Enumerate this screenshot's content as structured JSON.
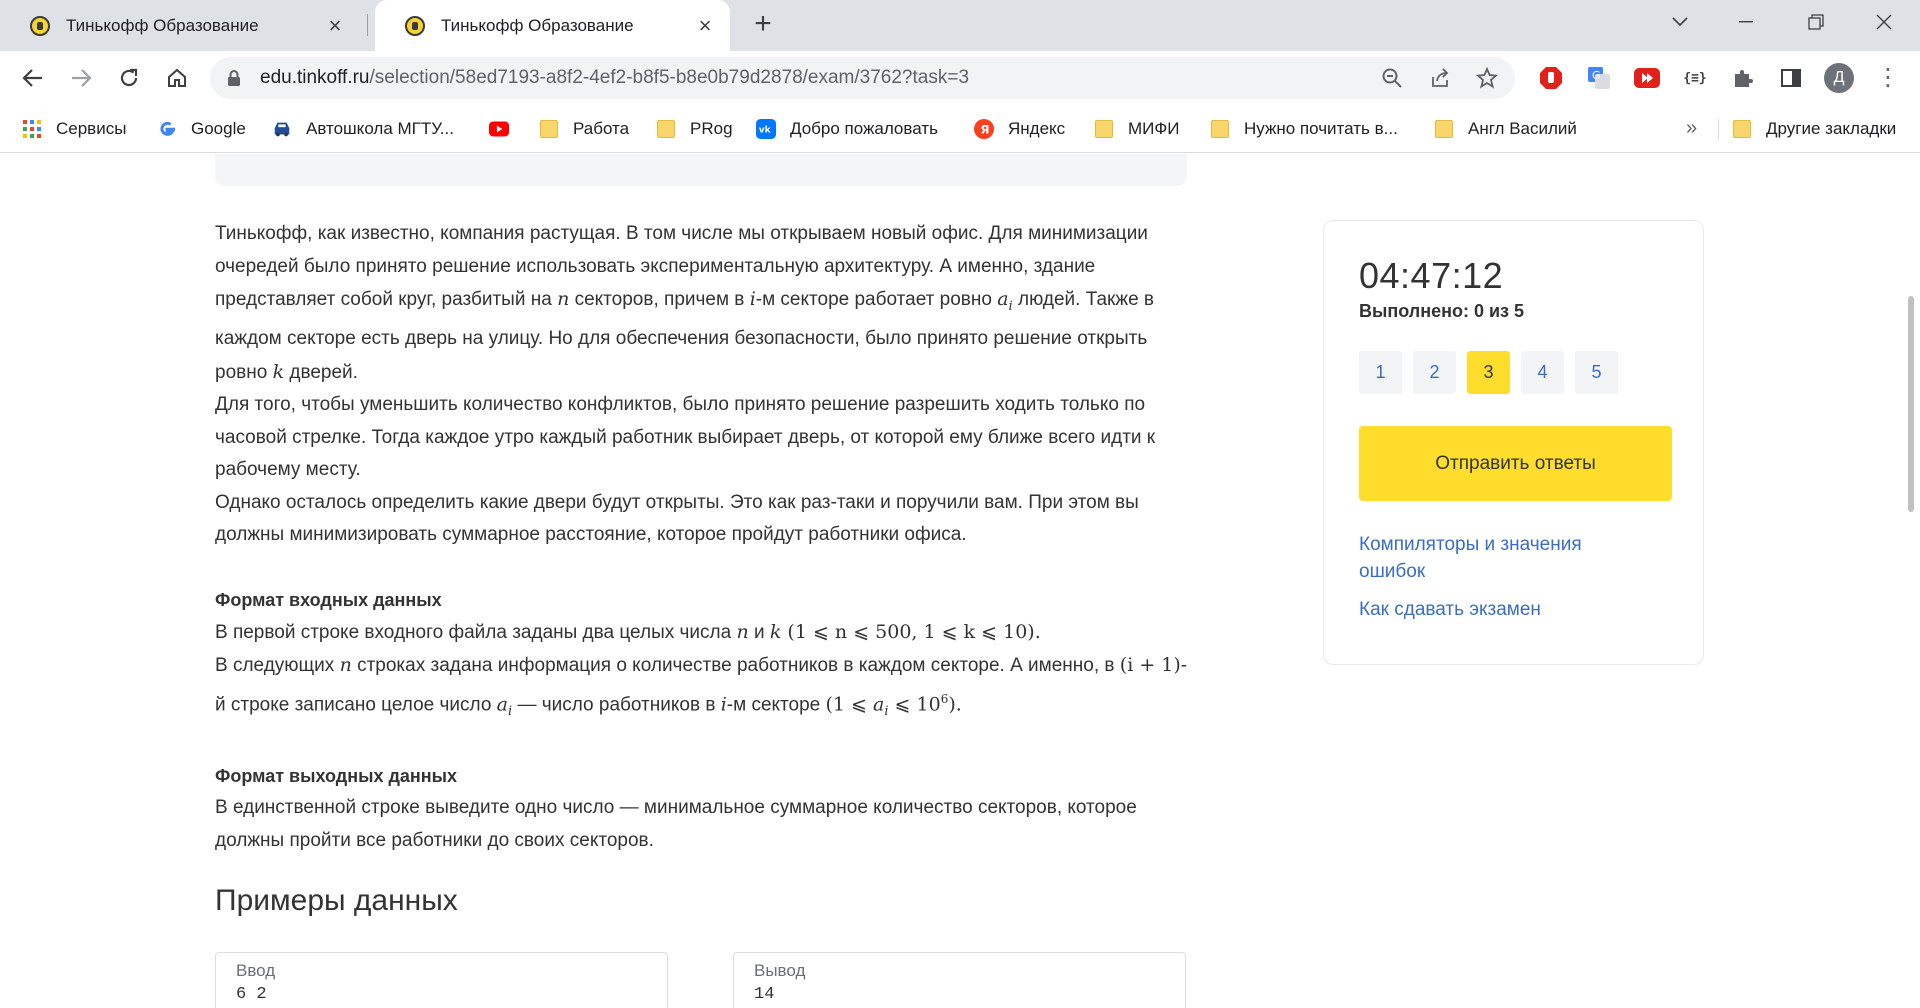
{
  "browser": {
    "tabs": [
      {
        "title": "Тинькофф Образование",
        "active": false
      },
      {
        "title": "Тинькофф Образование",
        "active": true
      }
    ],
    "new_tab_label": "+",
    "url_host": "edu.tinkoff.ru",
    "url_path": "/selection/58ed7193-a8f2-4ef2-b8f5-b8e0b79d2878/exam/3762?task=3",
    "profile_initial": "Д",
    "bookmarks": [
      {
        "label": "Сервисы",
        "icon": "apps-grid-icon"
      },
      {
        "label": "Google",
        "icon": "google-icon"
      },
      {
        "label": "Автошкола МГТУ...",
        "icon": "car-icon"
      },
      {
        "label": "",
        "icon": "youtube-icon"
      },
      {
        "label": "Работа",
        "icon": "folder-icon"
      },
      {
        "label": "PRog",
        "icon": "folder-icon"
      },
      {
        "label": "Добро пожаловать",
        "icon": "vk-icon"
      },
      {
        "label": "Яндекс",
        "icon": "yandex-icon"
      },
      {
        "label": "МИФИ",
        "icon": "folder-icon"
      },
      {
        "label": "Нужно почитать в...",
        "icon": "folder-icon"
      },
      {
        "label": "Англ Василий",
        "icon": "folder-icon"
      }
    ],
    "bookmarks_more": "»",
    "other_bookmarks": "Другие закладки"
  },
  "task": {
    "p1": {
      "a": "Тинькофф, как известно, компания растущая. В том числе мы открываем новый офис. Для минимизации очередей было принято решение использовать экспериментальную архитектуру. А именно, здание представляет собой круг, разбитый на ",
      "n": "n",
      "b": " секторов, причем в ",
      "i": "i",
      "c": "-м секторе работает ровно ",
      "ai": "a",
      "ai_sub": "i",
      "d": " людей. Также в каждом секторе есть дверь на улицу. Но для обеспечения безопасности, было принято решение открыть ровно ",
      "k": "k",
      "e": " дверей."
    },
    "p2": "Для того, чтобы уменьшить количество конфликтов, было принято решение разрешить ходить только по часовой стрелке. Тогда каждое утро каждый работник выбирает дверь, от которой ему ближе всего идти к рабочему месту.",
    "p3": "Однако осталось определить какие двери будут открыты. Это как раз-таки и поручили вам. При этом вы должны минимизировать суммарное расстояние, которое пройдут работники офиса.",
    "input_title": "Формат входных данных",
    "input_1": {
      "a": "В первой строке входного файла заданы два целых числа ",
      "n": "n",
      "and": " и ",
      "k": "k",
      "constraint": " (1 ⩽ n ⩽ 500, 1 ⩽ k ⩽ 10)."
    },
    "input_2": {
      "a": "В следующих ",
      "n": "n",
      "b": " строках задана информация о количестве работников в каждом секторе. А именно, в ",
      "i1": "(i + 1)",
      "c": "-й строке записано целое число ",
      "ai": "a",
      "ai_sub": "i",
      "d": " — число работников в ",
      "i": "i",
      "e": "-м секторе ",
      "constraint_a": "(1 ⩽ ",
      "constraint_ai": "a",
      "constraint_ai_sub": "i",
      "constraint_b": " ⩽ 10",
      "constraint_sup": "6",
      "constraint_c": ")."
    },
    "output_title": "Формат выходных данных",
    "output_1": "В единственной строке выведите одно число — минимальное суммарное количество секторов, которое должны пройти все работники до своих секторов."
  },
  "examples": {
    "title": "Примеры данных",
    "input_label": "Ввод",
    "input_value": "6 2",
    "output_label": "Вывод",
    "output_value": "14"
  },
  "sidebar": {
    "timer": "04:47:12",
    "progress": "Выполнено: 0 из 5",
    "tasks": [
      "1",
      "2",
      "3",
      "4",
      "5"
    ],
    "current_task": "3",
    "submit_label": "Отправить ответы",
    "link_compilers": "Компиляторы и значения ошибок",
    "link_howto": "Как сдавать экзамен"
  },
  "colors": {
    "accent_yellow": "#ffdd2d",
    "link_blue": "#3a6dc4",
    "text": "#333333"
  }
}
